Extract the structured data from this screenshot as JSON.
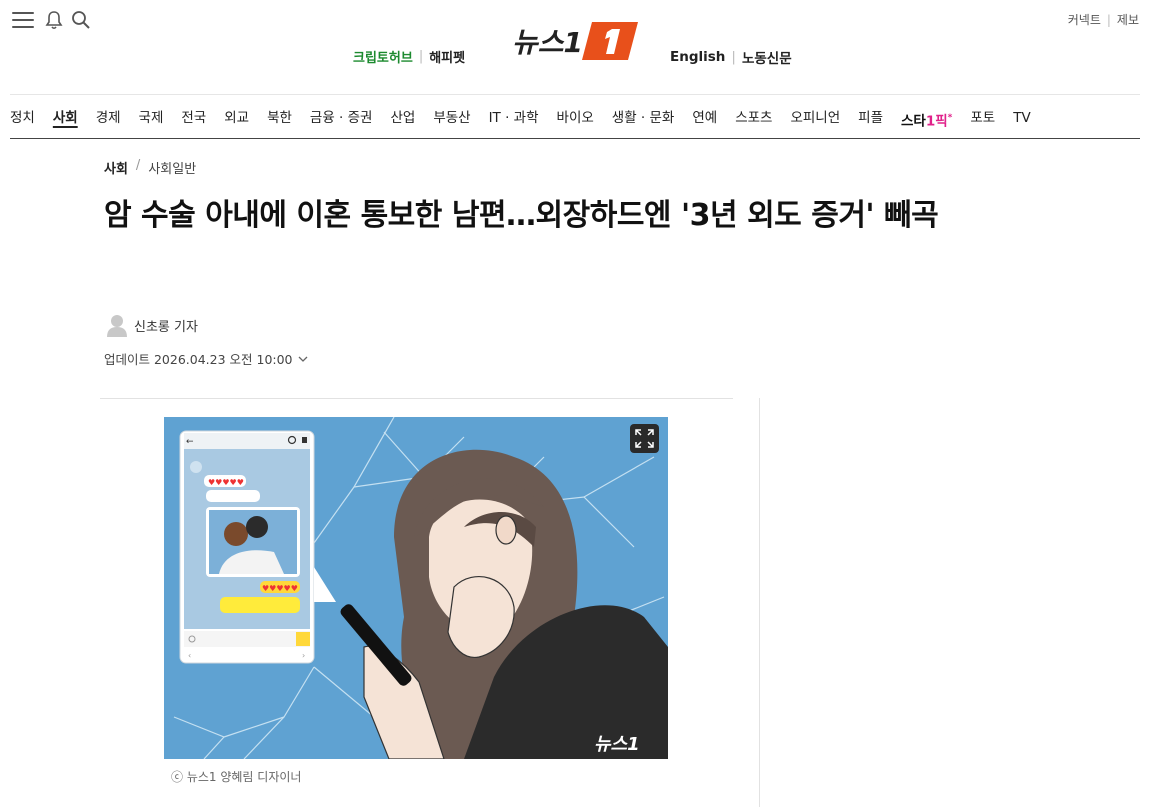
{
  "header": {
    "top_right": [
      "커넥트",
      "제보"
    ],
    "left_links": [
      "크립토허브",
      "해피펫"
    ],
    "logo_text": "뉴스1",
    "right_links": [
      "English",
      "노동신문"
    ]
  },
  "nav": {
    "items": [
      "정치",
      "사회",
      "경제",
      "국제",
      "전국",
      "외교",
      "북한",
      "금융 · 증권",
      "산업",
      "부동산",
      "IT · 과학",
      "바이오",
      "생활 · 문화",
      "연예",
      "스포츠",
      "오피니언",
      "피플"
    ],
    "star_pick": {
      "prefix": "스타",
      "pink": "1픽",
      "mark": "*"
    },
    "tail": [
      "포토",
      "TV"
    ],
    "active": "사회"
  },
  "article": {
    "breadcrumb": [
      "사회",
      "사회일반"
    ],
    "headline": "암 수술 아내에 이혼 통보한 남편…외장하드엔 '3년 외도 증거' 빼곡",
    "reporter": "신초롱 기자",
    "updated": "업데이트 2026.04.23 오전 10:00",
    "image_caption": "ⓒ 뉴스1 양혜림 디자이너",
    "image_watermark": "뉴스1"
  },
  "colors": {
    "accent": "#e8501b",
    "crypto_green": "#1c8a2f",
    "star_pink": "#e0218a",
    "illustration_bg": "#5fa2d2"
  }
}
